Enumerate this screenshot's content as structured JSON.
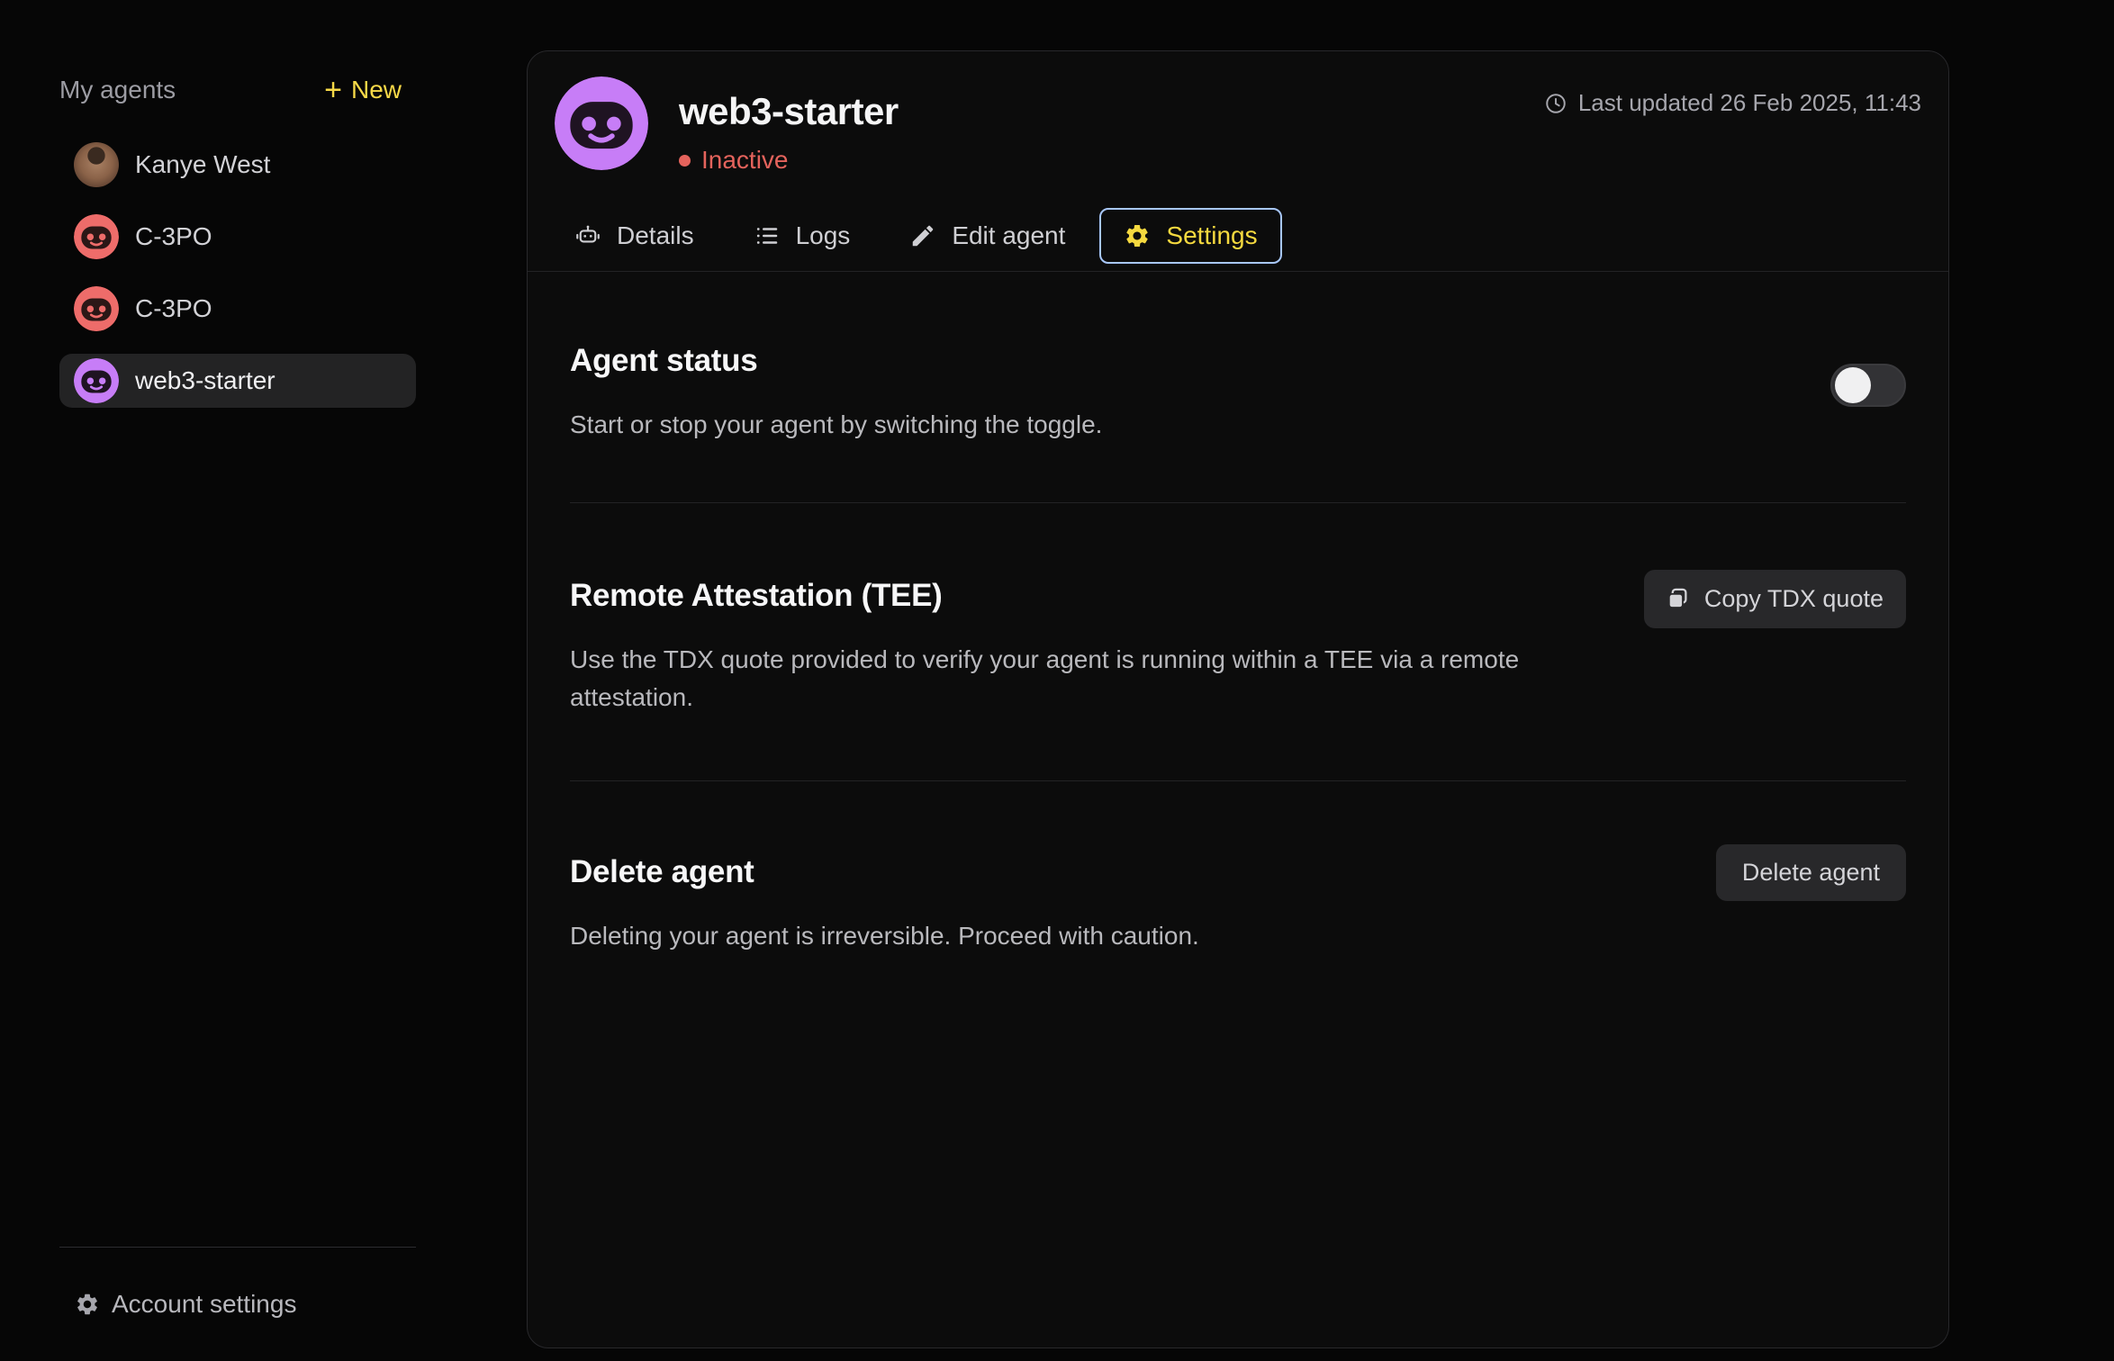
{
  "sidebar": {
    "title": "My agents",
    "new_button": "New",
    "agents": [
      {
        "name": "Kanye West",
        "avatar": "photo"
      },
      {
        "name": "C-3PO",
        "avatar": "robot-red"
      },
      {
        "name": "C-3PO",
        "avatar": "robot-red"
      },
      {
        "name": "web3-starter",
        "avatar": "robot-purple",
        "selected": true
      }
    ],
    "account_settings": "Account settings"
  },
  "header": {
    "agent_name": "web3-starter",
    "status": "Inactive",
    "last_updated": "Last updated 26 Feb 2025, 11:43"
  },
  "tabs": [
    {
      "label": "Details",
      "icon": "robot-icon",
      "active": false
    },
    {
      "label": "Logs",
      "icon": "list-icon",
      "active": false
    },
    {
      "label": "Edit agent",
      "icon": "pencil-icon",
      "active": false
    },
    {
      "label": "Settings",
      "icon": "gear-icon",
      "active": true
    }
  ],
  "sections": {
    "agent_status": {
      "title": "Agent status",
      "description": "Start or stop your agent by switching the toggle.",
      "toggle_state": "off"
    },
    "remote_attestation": {
      "title": "Remote Attestation (TEE)",
      "button": "Copy TDX quote",
      "button_icon": "copy-icon",
      "description": "Use the TDX quote provided to verify your agent is running within a TEE via a remote attestation."
    },
    "delete_agent": {
      "title": "Delete agent",
      "button": "Delete agent",
      "description": "Deleting your agent is irreversible. Proceed with caution."
    }
  },
  "colors": {
    "accent_yellow": "#f7d948",
    "status_red": "#e4635c",
    "focus_ring": "#a8c7fa",
    "avatar_purple": "#c77df7",
    "avatar_red": "#ee6c6a"
  }
}
